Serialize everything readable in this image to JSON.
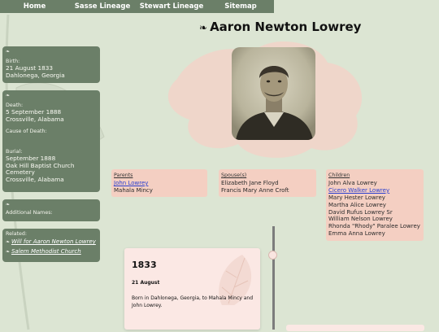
{
  "nav": [
    "Home",
    "Sasse Lineage",
    "Stewart Lineage",
    "Sitemap"
  ],
  "person": {
    "name": "Aaron Newton Lowrey",
    "fleuron": "❧"
  },
  "birth": {
    "label": "Birth:",
    "date": "21 August 1833",
    "place": "Dahlonega, Georgia"
  },
  "death": {
    "label": "Death:",
    "date": "5 September 1888",
    "place": "Crossville, Alabama",
    "cause_label": "Cause of Death:"
  },
  "burial": {
    "label": "Burial:",
    "date": "September 1888",
    "place_line1": "Oak Hill Baptist Church",
    "place_line2": "Cemetery",
    "place_line3": "Crossville, Alabama"
  },
  "additional": {
    "label": "Additional Names:"
  },
  "related": {
    "label": "Related:",
    "links": [
      "Will for Aaron Newton Lowrey",
      "Salem Methodist Church"
    ]
  },
  "parents": {
    "header": "Parents",
    "items": [
      {
        "name": "John Lowrey",
        "link": true
      },
      {
        "name": "Mahala Mincy",
        "link": false
      }
    ]
  },
  "spouses": {
    "header": "Spouse(s)",
    "items": [
      {
        "name": "Elizabeth Jane Floyd",
        "link": false
      },
      {
        "name": "Francis Mary Anne Croft",
        "link": false
      }
    ]
  },
  "children": {
    "header": "Children",
    "items": [
      {
        "name": "John Alva Lowrey",
        "link": false
      },
      {
        "name": "Cicero Walker Lowrey",
        "link": true
      },
      {
        "name": "Mary Hester Lowrey",
        "link": false
      },
      {
        "name": "Martha Alice Lowrey",
        "link": false
      },
      {
        "name": "David Rufus Lowrey Sr",
        "link": false
      },
      {
        "name": "William Nelson Lowrey",
        "link": false
      },
      {
        "name": "Rhonda \"Rhody\" Paralee Lowrey",
        "link": false
      },
      {
        "name": "Emma Anna Lowrey",
        "link": false
      }
    ]
  },
  "timeline": {
    "events": [
      {
        "year": "1833",
        "date": "21 August",
        "description": "Born in Dahlonega, Georgia, to Mahala Mincy and John Lowrey."
      }
    ]
  },
  "colors": {
    "nav": "#6b7f68",
    "background": "#dce5d3",
    "card": "#f4cfc2",
    "link": "#2a3fcf"
  }
}
